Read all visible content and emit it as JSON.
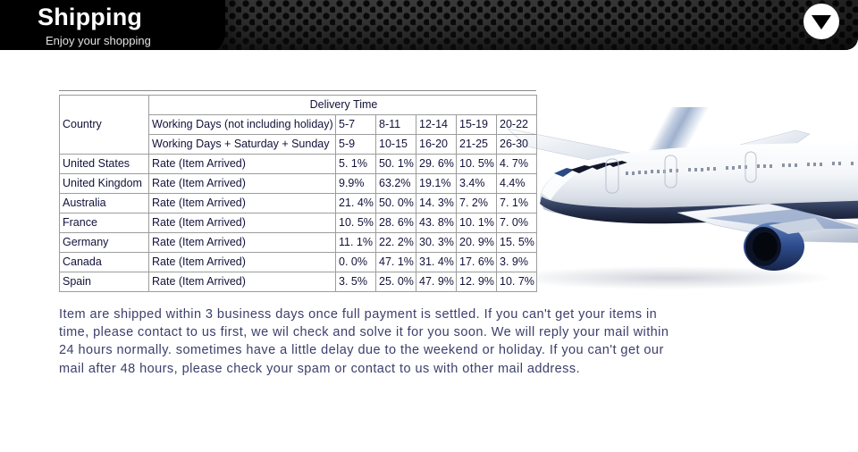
{
  "banner": {
    "title": "Shipping",
    "subtitle": "Enjoy your shopping",
    "badge_icon": "triangle-down-icon",
    "background_color": "#1a1a1a",
    "title_color": "#ffffff"
  },
  "artwork": {
    "plane_icon": "airplane-image",
    "contrail_icon": "contrail-streak"
  },
  "table": {
    "header": {
      "country_label": "Country",
      "delivery_time_label": "Delivery Time",
      "working_days_label": "Working Days (not including holiday)",
      "working_days_weekend_label": "Working Days + Saturday + Sunday",
      "working_days_values": [
        "5-7",
        "8-11",
        "12-14",
        "15-19",
        "20-22"
      ],
      "working_days_weekend_values": [
        "5-9",
        "10-15",
        "16-20",
        "21-25",
        "26-30"
      ]
    },
    "metric_label": "Rate (Item Arrived)",
    "rows": [
      {
        "country": "United States",
        "metric": "Rate (Item Arrived)",
        "values": [
          "5. 1%",
          "50. 1%",
          "29. 6%",
          "10. 5%",
          "4. 7%"
        ]
      },
      {
        "country": "United Kingdom",
        "metric": "Rate (Item Arrived)",
        "values": [
          "9.9%",
          "63.2%",
          "19.1%",
          "3.4%",
          "4.4%"
        ]
      },
      {
        "country": "Australia",
        "metric": "Rate (Item Arrived)",
        "values": [
          "21. 4%",
          "50. 0%",
          "14. 3%",
          "7. 2%",
          "7. 1%"
        ]
      },
      {
        "country": "France",
        "metric": "Rate (Item Arrived)",
        "values": [
          "10. 5%",
          "28. 6%",
          "43. 8%",
          "10. 1%",
          "7. 0%"
        ]
      },
      {
        "country": "Germany",
        "metric": "Rate (Item Arrived)",
        "values": [
          "11. 1%",
          "22. 2%",
          "30. 3%",
          "20. 9%",
          "15. 5%"
        ]
      },
      {
        "country": "Canada",
        "metric": "Rate (Item Arrived)",
        "values": [
          "0. 0%",
          "47. 1%",
          "31. 4%",
          "17. 6%",
          "3. 9%"
        ]
      },
      {
        "country": "Spain",
        "metric": "Rate (Item Arrived)",
        "values": [
          "3. 5%",
          "25. 0%",
          "47. 9%",
          "12. 9%",
          "10. 7%"
        ]
      }
    ]
  },
  "note": {
    "text": "Item are shipped within 3 business days once full payment is settled. If you can't get your items in time, please contact to us first, we wil check and solve it for you soon. We will reply your mail within 24 hours normally. sometimes have a little delay due to the weekend or holiday. If you can't get our mail after 48 hours, please check your spam or contact to us with other mail address.",
    "color": "#3b3f6b"
  }
}
